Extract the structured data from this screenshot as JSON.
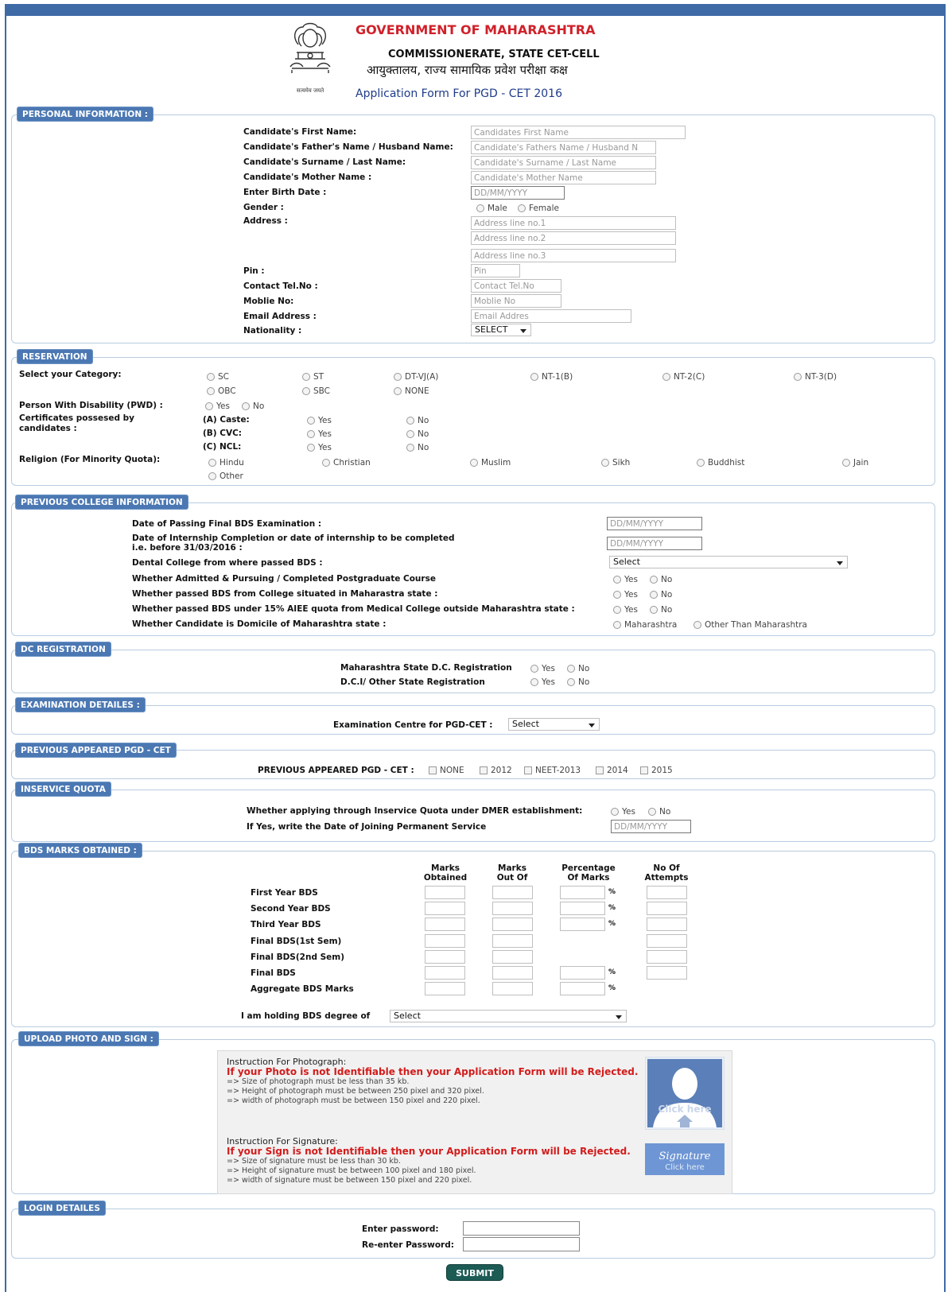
{
  "header": {
    "line1": "GOVERNMENT OF MAHARASHTRA",
    "line2": "COMMISSIONERATE, STATE CET-CELL",
    "line3": "आयुक्तालय, राज्य सामायिक प्रवेश परीक्षा कक्ष",
    "line4": "Application Form For PGD - CET 2016",
    "motto": "सत्यमेव जयते"
  },
  "personal": {
    "legend": "PERSONAL INFORMATION :",
    "first_name_label": "Candidate's First Name:",
    "first_name_ph": "Candidates First Name",
    "father_label": "Candidate's Father's Name / Husband Name:",
    "father_ph": "Candidate's Fathers Name / Husband N",
    "surname_label": "Candidate's Surname / Last Name:",
    "surname_ph": "Candidate's Surname / Last Name",
    "mother_label": "Candidate's Mother Name :",
    "mother_ph": "Candidate's Mother Name",
    "birth_label": "Enter Birth Date :",
    "birth_ph": "DD/MM/YYYY",
    "gender_label": "Gender :",
    "male": "Male",
    "female": "Female",
    "address_label": "Address :",
    "addr1_ph": "Address line no.1",
    "addr2_ph": "Address line no.2",
    "addr3_ph": "Address line no.3",
    "pin_label": "Pin :",
    "pin_ph": "Pin",
    "tel_label": "Contact Tel.No :",
    "tel_ph": "Contact Tel.No",
    "mobile_label": "Moblie No:",
    "mobile_ph": "Moblie No",
    "email_label": "Email Address :",
    "email_ph": "Email Addres",
    "nationality_label": "Nationality :",
    "nationality_value": "SELECT"
  },
  "reservation": {
    "legend": "RESERVATION",
    "category_label": "Select your Category:",
    "categories": [
      "SC",
      "ST",
      "DT-VJ(A)",
      "NT-1(B)",
      "NT-2(C)",
      "NT-3(D)",
      "OBC",
      "SBC",
      "NONE"
    ],
    "pwd_label": "Person With Disability (PWD) :",
    "yes": "Yes",
    "no": "No",
    "cert_label_1": "Certificates possesed by",
    "cert_label_2": "candidates :",
    "caste": "(A) Caste:",
    "cvc": "(B) CVC:",
    "ncl": "(C) NCL:",
    "religion_label": "Religion (For Minority Quota):",
    "religions": [
      "Hindu",
      "Christian",
      "Muslim",
      "Sikh",
      "Buddhist",
      "Jain",
      "Other"
    ]
  },
  "college": {
    "legend": "PREVIOUS COLLEGE INFORMATION",
    "q1": "Date of Passing Final BDS Examination :",
    "q2a": "Date of Internship Completion or date of internship to be completed",
    "q2b": "i.e. before 31/03/2016 :",
    "q3": "Dental College from where passed BDS :",
    "q4": "Whether Admitted & Pursuing / Completed Postgraduate Course",
    "q5": "Whether passed BDS from College situated in Maharastra state :",
    "q6": "Whether passed BDS under 15% AIEE quota from Medical College outside Maharashtra state :",
    "q7": "Whether Candidate is Domicile of Maharashtra state :",
    "date_ph": "DD/MM/YYYY",
    "college_value": "Select",
    "yes": "Yes",
    "no": "No",
    "maharashtra": "Maharashtra",
    "other_than": "Other Than Maharashtra"
  },
  "dc": {
    "legend": "DC REGISTRATION",
    "q1": "Maharashtra State D.C. Registration",
    "q2": "D.C.I/ Other State Registration",
    "yes": "Yes",
    "no": "No"
  },
  "exam": {
    "legend": "EXAMINATION DETAILES :",
    "label": "Examination Centre for PGD-CET :",
    "value": "Select"
  },
  "previous": {
    "legend": "PREVIOUS APPEARED PGD - CET",
    "label": "PREVIOUS APPEARED PGD - CET :",
    "options": [
      "NONE",
      "2012",
      "NEET-2013",
      "2014",
      "2015"
    ]
  },
  "inservice": {
    "legend": "INSERVICE QUOTA",
    "q1": "Whether applying through Inservice Quota under DMER establishment:",
    "q2": "If Yes, write the Date of Joining Permanent Service",
    "yes": "Yes",
    "no": "No",
    "date_ph": "DD/MM/YYYY"
  },
  "marks": {
    "legend": "BDS MARKS OBTAINED :",
    "col1a": "Marks",
    "col1b": "Obtained",
    "col2a": "Marks",
    "col2b": "Out Of",
    "col3a": "Percentage",
    "col3b": "Of Marks",
    "col4a": "No Of",
    "col4b": "Attempts",
    "rows": [
      "First Year BDS",
      "Second Year BDS",
      "Third Year BDS",
      "Final BDS(1st Sem)",
      "Final BDS(2nd Sem)",
      "Final BDS",
      "Aggregate BDS Marks"
    ],
    "pct": "%",
    "degree_label": "I am holding BDS degree of",
    "degree_value": "Select"
  },
  "upload": {
    "legend": "UPLOAD PHOTO AND SIGN :",
    "photo_head": "Instruction For Photograph:",
    "photo_red": "If your Photo is not Identifiable then your Application Form will be Rejected.",
    "photo_l1": "=> Size of photograph must be less than 35 kb.",
    "photo_l2": "=> Height of photograph must be between 250 pixel and 320 pixel.",
    "photo_l3": "=> width of photograph must be between 150 pixel and 220 pixel.",
    "sign_head": "Instruction For Signature:",
    "sign_red": "If your Sign is not Identifiable then your Application Form will be Rejected.",
    "sign_l1": "=> Size of signature must be less than 30 kb.",
    "sign_l2": "=> Height of signature must be between 100 pixel and 180 pixel.",
    "sign_l3": "=> width of signature must be between 150 pixel and 220 pixel.",
    "photo_click": "Click here",
    "sign_word": "Signature",
    "sign_click": "Click here"
  },
  "login": {
    "legend": "LOGIN DETAILES",
    "password_label": "Enter password:",
    "repassword_label": "Re-enter Password:"
  },
  "submit_label": "SUBMIT"
}
